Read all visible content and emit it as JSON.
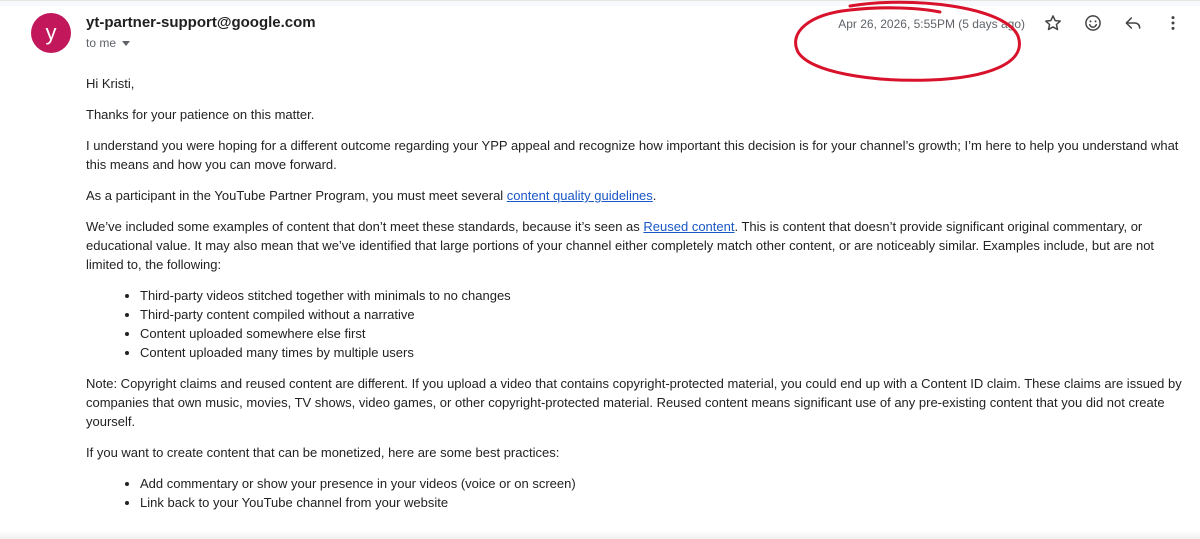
{
  "header": {
    "avatar_letter": "y",
    "sender": "yt-partner-support@google.com",
    "recipient": "to me",
    "date": "Apr 26, 2026, 5:55PM (5 days ago)",
    "colors": {
      "avatar_bg": "#c2185b",
      "annotation": "#d9122b"
    },
    "icons": [
      "star-icon",
      "emoji-icon",
      "reply-icon",
      "more-vert-icon"
    ]
  },
  "body": {
    "greeting": "Hi Kristi,",
    "p1": "Thanks for your patience on this matter.",
    "p2": "I understand you were hoping for a different outcome regarding your YPP appeal and recognize how important this decision is for your channel’s growth; I’m here to help you understand what this means and how you can move forward.",
    "p3_before": "As a participant in the YouTube Partner Program, you must meet several ",
    "p3_link": "content quality guidelines",
    "p3_after": ".",
    "p4_before": "We’ve included some examples of content that don’t meet these standards, because it’s seen as ",
    "p4_link": "Reused content",
    "p4_after": ". This is content that doesn’t provide significant original commentary, or educational value. It may also mean that we’ve identified that large portions of your channel either completely match other content, or are noticeably similar. Examples include, but are not limited to, the following:",
    "list1": [
      "Third-party videos stitched together with minimals to no changes",
      "Third-party content compiled without a narrative",
      "Content uploaded somewhere else first",
      "Content uploaded many times by multiple users"
    ],
    "p5": "Note: Copyright claims and reused content are different. If you upload a video that contains copyright-protected material, you could end up with a Content ID claim. These claims are issued by companies that own music, movies, TV shows, video games, or other copyright-protected material. Reused content means significant use of any pre-existing content that you did not create yourself.",
    "p6": "If you want to create content that can be monetized, here are some best practices:",
    "list2": [
      "Add commentary or show your presence in your videos (voice or on screen)",
      "Link back to your YouTube channel from your website"
    ]
  }
}
